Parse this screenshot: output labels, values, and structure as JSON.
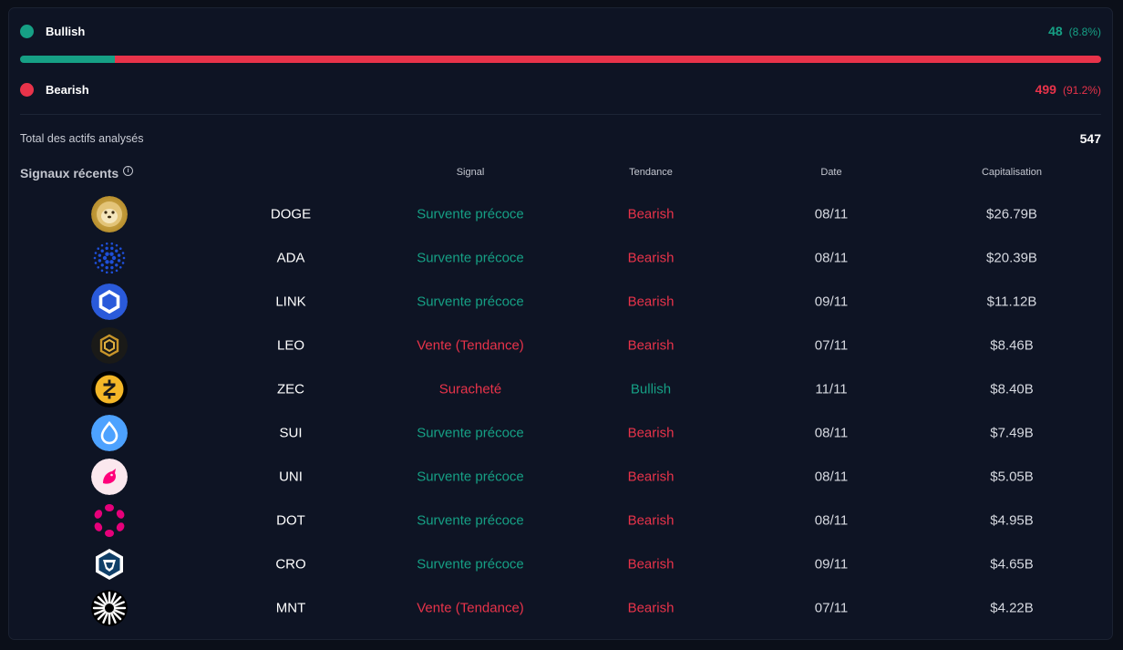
{
  "summary": {
    "bullish": {
      "label": "Bullish",
      "count": "48",
      "pct": "(8.8%)",
      "fraction": 0.0878,
      "color": "#16a085"
    },
    "bearish": {
      "label": "Bearish",
      "count": "499",
      "pct": "(91.2%)",
      "fraction": 0.9122,
      "color": "#e8334a"
    },
    "total_label": "Total des actifs analysés",
    "total_value": "547"
  },
  "section": {
    "title": "Signaux récents",
    "icon": "info-icon"
  },
  "table": {
    "headers": {
      "signal": "Signal",
      "tendance": "Tendance",
      "date": "Date",
      "cap": "Capitalisation"
    },
    "rows": [
      {
        "logo": "doge-logo",
        "symbol": "DOGE",
        "signal": "Survente précoce",
        "signal_color": "#16a085",
        "trend": "Bearish",
        "trend_color": "#e8334a",
        "date": "08/11",
        "cap": "$26.79B"
      },
      {
        "logo": "ada-logo",
        "symbol": "ADA",
        "signal": "Survente précoce",
        "signal_color": "#16a085",
        "trend": "Bearish",
        "trend_color": "#e8334a",
        "date": "08/11",
        "cap": "$20.39B"
      },
      {
        "logo": "link-logo",
        "symbol": "LINK",
        "signal": "Survente précoce",
        "signal_color": "#16a085",
        "trend": "Bearish",
        "trend_color": "#e8334a",
        "date": "09/11",
        "cap": "$11.12B"
      },
      {
        "logo": "leo-logo",
        "symbol": "LEO",
        "signal": "Vente (Tendance)",
        "signal_color": "#e8334a",
        "trend": "Bearish",
        "trend_color": "#e8334a",
        "date": "07/11",
        "cap": "$8.46B"
      },
      {
        "logo": "zec-logo",
        "symbol": "ZEC",
        "signal": "Suracheté",
        "signal_color": "#e8334a",
        "trend": "Bullish",
        "trend_color": "#16a085",
        "date": "11/11",
        "cap": "$8.40B"
      },
      {
        "logo": "sui-logo",
        "symbol": "SUI",
        "signal": "Survente précoce",
        "signal_color": "#16a085",
        "trend": "Bearish",
        "trend_color": "#e8334a",
        "date": "08/11",
        "cap": "$7.49B"
      },
      {
        "logo": "uni-logo",
        "symbol": "UNI",
        "signal": "Survente précoce",
        "signal_color": "#16a085",
        "trend": "Bearish",
        "trend_color": "#e8334a",
        "date": "08/11",
        "cap": "$5.05B"
      },
      {
        "logo": "dot-logo",
        "symbol": "DOT",
        "signal": "Survente précoce",
        "signal_color": "#16a085",
        "trend": "Bearish",
        "trend_color": "#e8334a",
        "date": "08/11",
        "cap": "$4.95B"
      },
      {
        "logo": "cro-logo",
        "symbol": "CRO",
        "signal": "Survente précoce",
        "signal_color": "#16a085",
        "trend": "Bearish",
        "trend_color": "#e8334a",
        "date": "09/11",
        "cap": "$4.65B"
      },
      {
        "logo": "mnt-logo",
        "symbol": "MNT",
        "signal": "Vente (Tendance)",
        "signal_color": "#e8334a",
        "trend": "Bearish",
        "trend_color": "#e8334a",
        "date": "07/11",
        "cap": "$4.22B"
      }
    ]
  }
}
